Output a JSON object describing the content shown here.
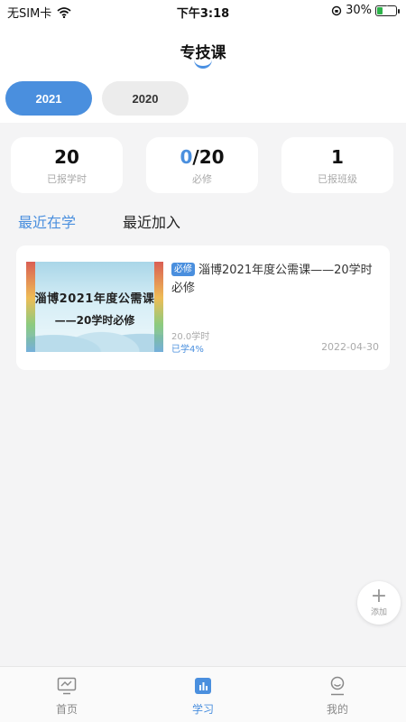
{
  "status_bar": {
    "carrier": "无SIM卡",
    "time": "下午3:18",
    "battery": "30%",
    "battery_level": 0.3
  },
  "header": {
    "title": "专技课"
  },
  "year_tabs": [
    {
      "label": "2021",
      "active": true
    },
    {
      "label": "2020",
      "active": false
    }
  ],
  "stats": [
    {
      "value": "20",
      "label": "已报学时"
    },
    {
      "value_done": "0",
      "value_total": "/20",
      "label": "必修"
    },
    {
      "value": "1",
      "label": "已报班级"
    }
  ],
  "filter_tabs": [
    {
      "label": "最近在学",
      "active": true
    },
    {
      "label": "最近加入",
      "active": false
    }
  ],
  "courses": [
    {
      "thumb_line1": "淄博2021年度公需课",
      "thumb_line2": "——20学时必修",
      "badge": "必修",
      "title": "淄博2021年度公需课——20学时必修",
      "hours": "20.0学时",
      "progress": "已学4%",
      "date": "2022-04-30"
    }
  ],
  "fab": {
    "icon": "plus-icon",
    "label": "添加"
  },
  "bottom_nav": [
    {
      "label": "首页",
      "icon": "monitor-icon",
      "active": false
    },
    {
      "label": "学习",
      "icon": "chart-book-icon",
      "active": true
    },
    {
      "label": "我的",
      "icon": "user-icon",
      "active": false
    }
  ],
  "colors": {
    "accent": "#4a8fde",
    "background": "#f4f4f5",
    "card": "#ffffff",
    "muted_text": "#aaaaaa"
  }
}
